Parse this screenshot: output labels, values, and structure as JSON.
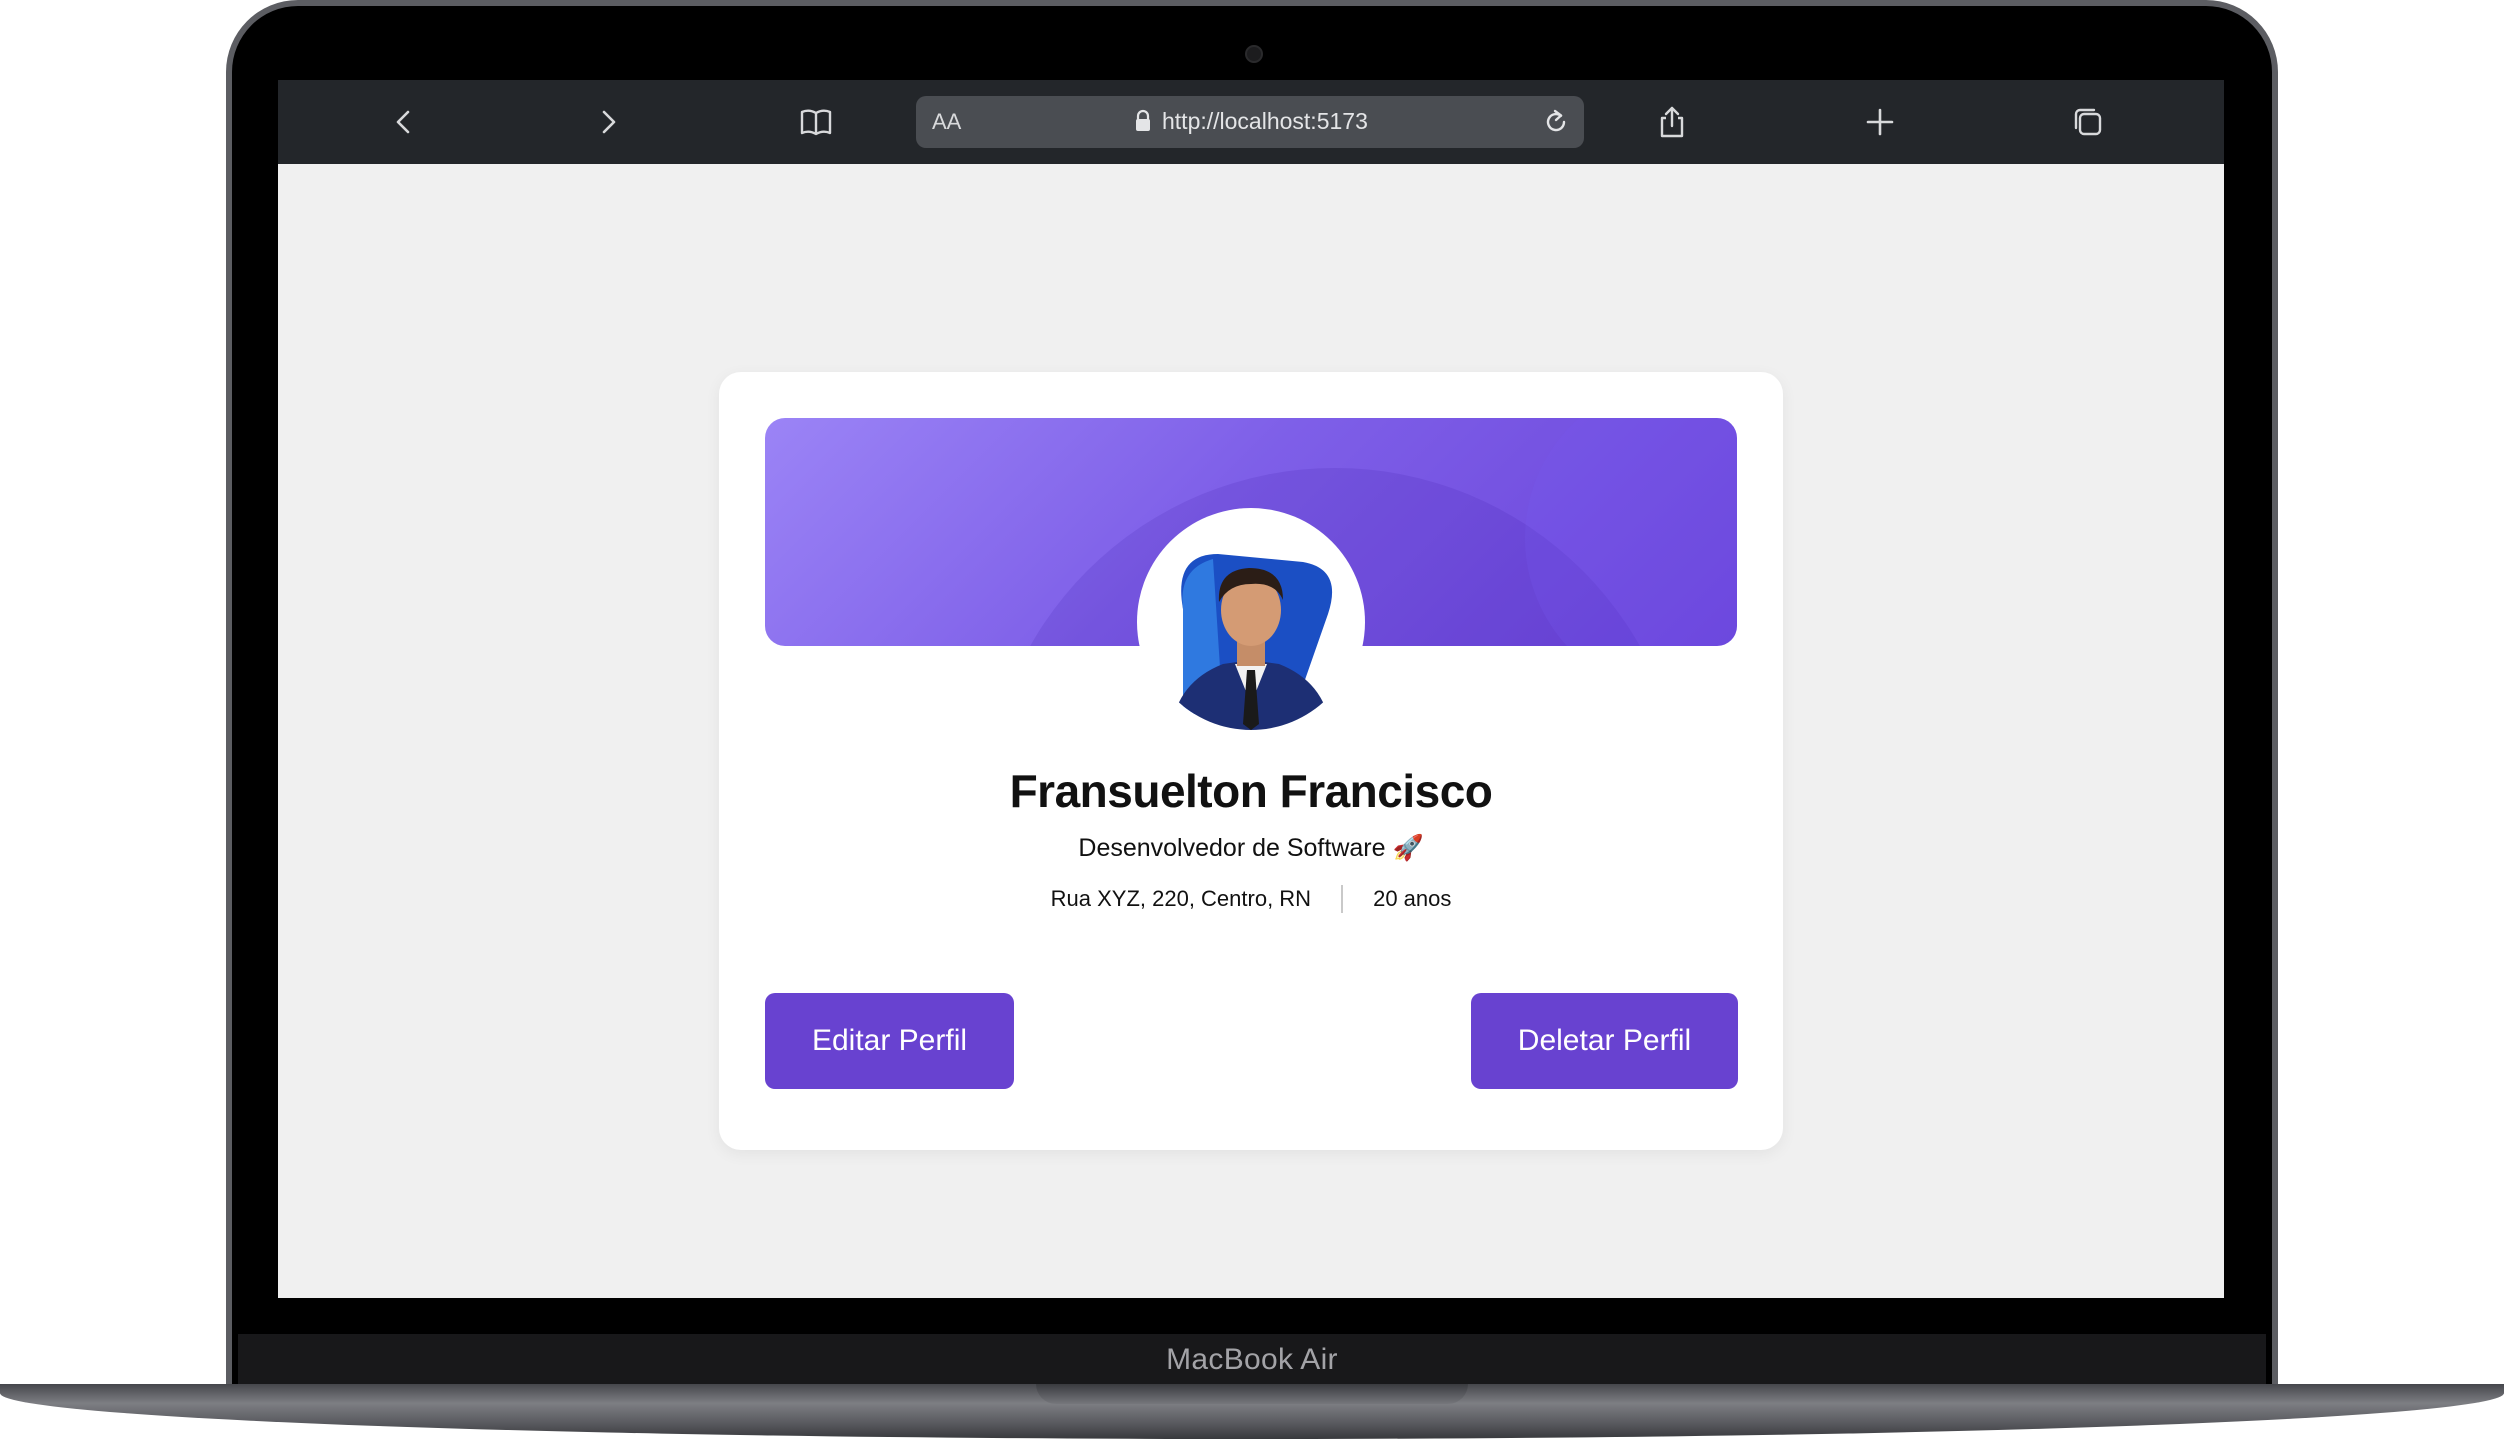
{
  "device": {
    "label": "MacBook Air"
  },
  "browser": {
    "text_size_label": "AA",
    "url": "http://localhost:5173",
    "icons": {
      "back": "chevron-left-icon",
      "forward": "chevron-right-icon",
      "bookmarks": "book-icon",
      "lock": "lock-icon",
      "reload": "reload-icon",
      "share": "share-icon",
      "new_tab": "plus-icon",
      "tabs": "tabs-icon"
    }
  },
  "profile": {
    "name": "Fransuelton Francisco",
    "role": "Desenvolvedor de Software 🚀",
    "address": "Rua XYZ, 220, Centro, RN",
    "age": "20 anos",
    "edit_button": "Editar Perfil",
    "delete_button": "Deletar Perfil"
  },
  "colors": {
    "accent": "#6842d0",
    "banner_start": "#9b84f6",
    "banner_end": "#6a43d9",
    "page_background": "#f0f0f0",
    "toolbar_background": "#23262a"
  }
}
